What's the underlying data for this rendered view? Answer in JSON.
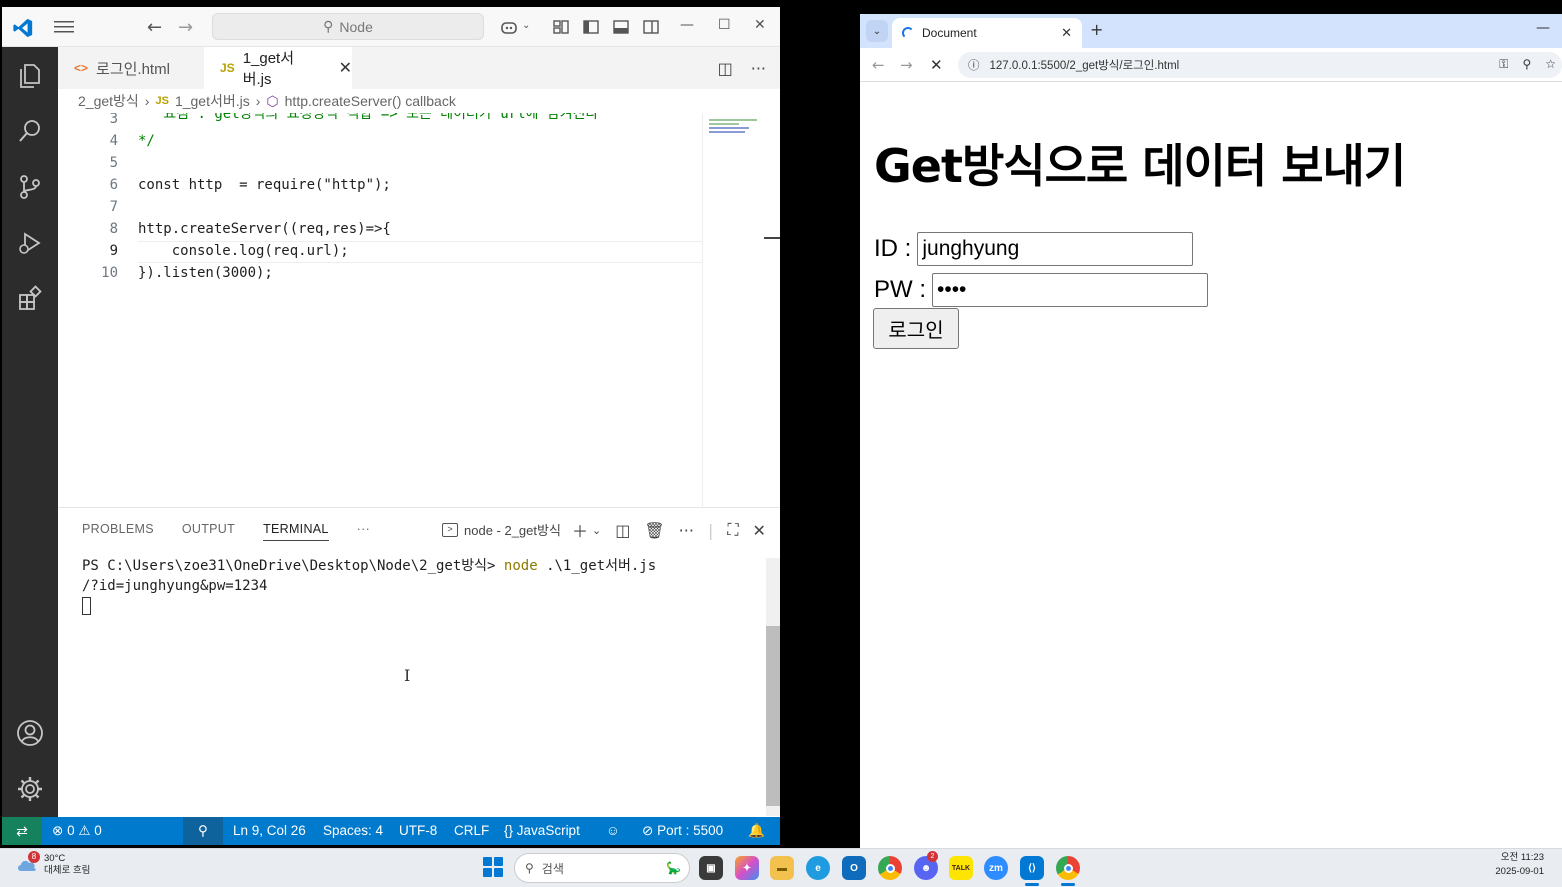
{
  "vscode": {
    "search_placeholder": "Node",
    "tabs": [
      {
        "label": "로그인.html",
        "icon": "<>"
      },
      {
        "label": "1_get서버.js",
        "icon": "JS"
      }
    ],
    "breadcrumb": [
      "2_get방식",
      "1_get서버.js",
      "http.createServer() callback"
    ],
    "code_lines": [
      {
        "num": "3",
        "text": "   요점 : get방식의 요청방식 적합 => 모든 데이터가 url에 담겨진다"
      },
      {
        "num": "4",
        "text": "*/"
      },
      {
        "num": "5",
        "text": ""
      },
      {
        "num": "6",
        "text": "const http  = require(\"http\");"
      },
      {
        "num": "7",
        "text": ""
      },
      {
        "num": "8",
        "text": "http.createServer((req,res)=>{"
      },
      {
        "num": "9",
        "text": "    console.log(req.url);"
      },
      {
        "num": "10",
        "text": "}).listen(3000);"
      }
    ],
    "panel_tabs": [
      "PROBLEMS",
      "OUTPUT",
      "TERMINAL"
    ],
    "panel_more": "···",
    "terminal_name": "node - 2_get방식",
    "terminal": {
      "prompt": "PS C:\\Users\\zoe31\\OneDrive\\Desktop\\Node\\2_get방식> ",
      "command": "node",
      "args": " .\\1_get서버.js",
      "output": "/?id=junghyung&pw=1234"
    },
    "status": {
      "errors": "0",
      "warnings": "0",
      "position": "Ln 9, Col 26",
      "spaces": "Spaces: 4",
      "encoding": "UTF-8",
      "eol": "CRLF",
      "language": "JavaScript",
      "port": "Port : 5500"
    }
  },
  "browser": {
    "tab_title": "Document",
    "url": "127.0.0.1:5500/2_get방식/로그인.html",
    "heading": "Get방식으로 데이터 보내기",
    "id_label": "ID :",
    "id_value": "junghyung",
    "pw_label": "PW :",
    "pw_value": "••••",
    "login_button": "로그인"
  },
  "taskbar": {
    "weather_badge": "8",
    "temperature": "30°C",
    "weather_desc": "대체로 흐림",
    "search_placeholder": "검색",
    "time": "오전 11:23",
    "date": "2025-09-01",
    "kakao_label": "TALK",
    "zoom_label": "zm",
    "discord_badge": "2"
  }
}
